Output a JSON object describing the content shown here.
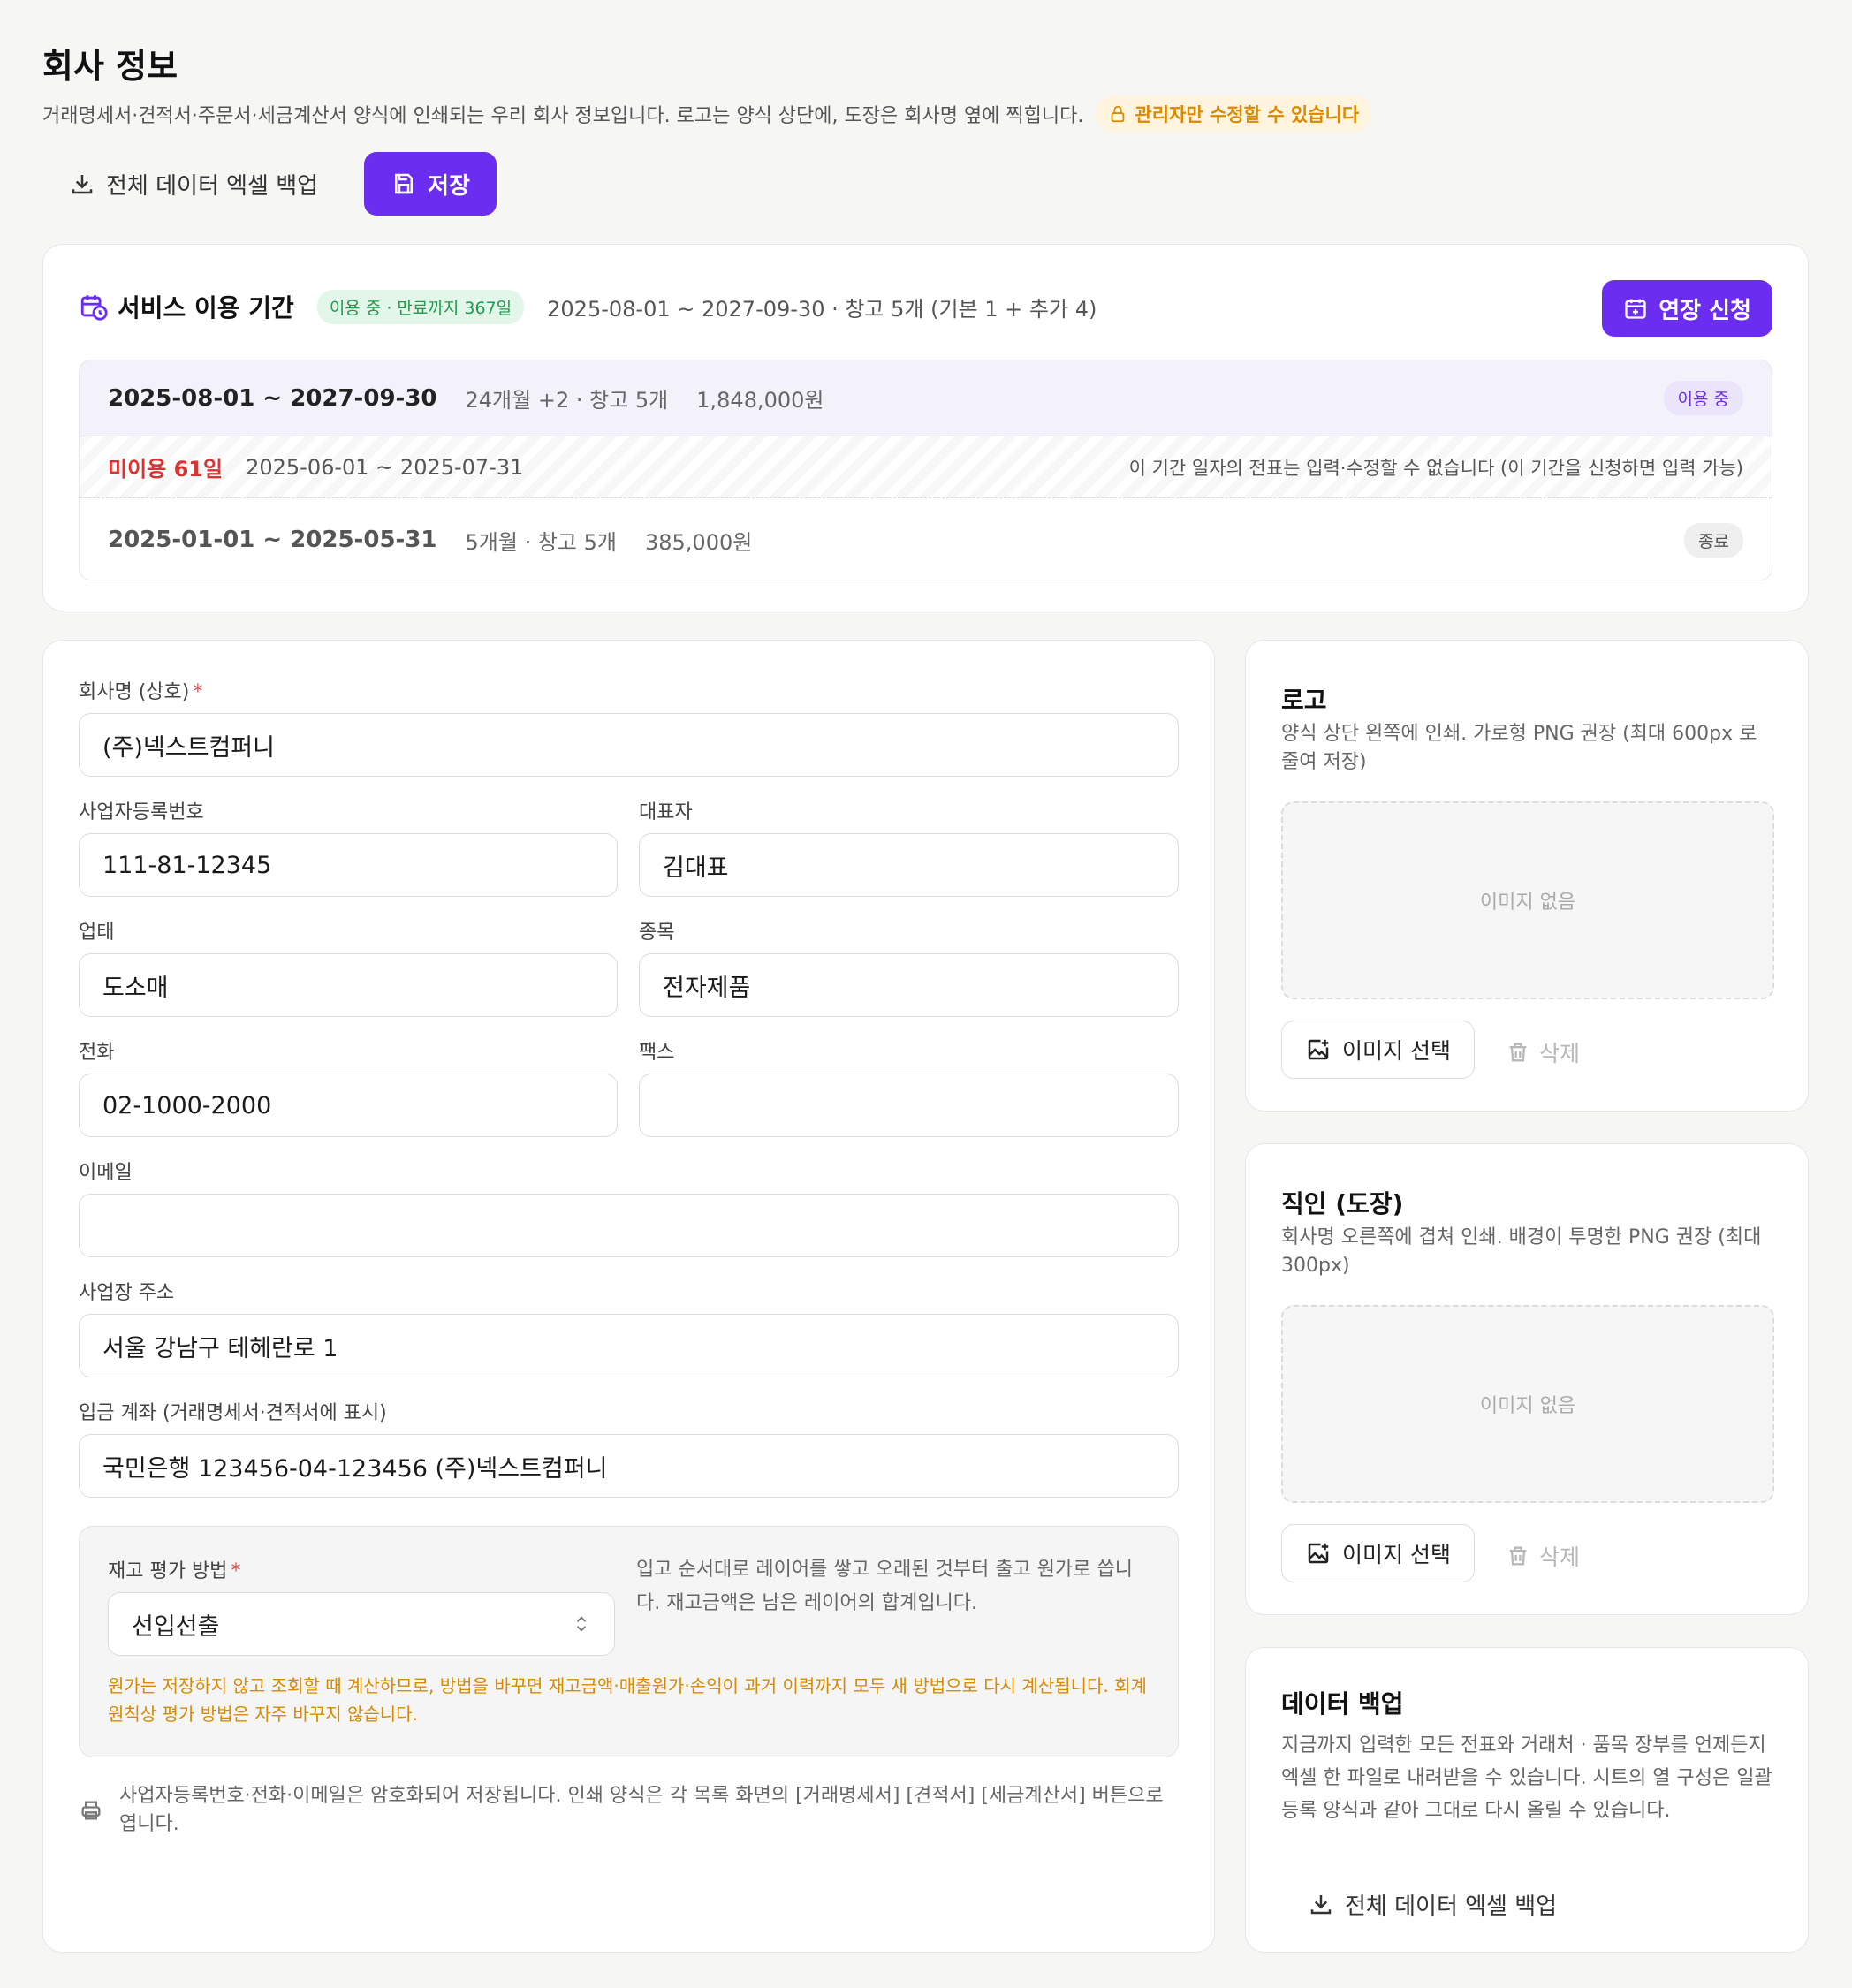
{
  "header": {
    "title": "회사 정보",
    "subtitle": "거래명세서·견적서·주문서·세금계산서 양식에 인쇄되는 우리 회사 정보입니다. 로고는 양식 상단에, 도장은 회사명 옆에 찍힙니다.",
    "admin_badge": "관리자만 수정할 수 있습니다"
  },
  "toolbar": {
    "export_label": "전체 데이터 엑셀 백업",
    "save_label": "저장"
  },
  "service": {
    "title": "서비스 이용 기간",
    "status_badge": "이용 중 · 만료까지 367일",
    "summary": "2025-08-01 ~ 2027-09-30 · 창고 5개 (기본 1 + 추가 4)",
    "extend_label": "연장 신청",
    "periods": [
      {
        "range": "2025-08-01 ~ 2027-09-30",
        "meta": "24개월 +2 · 창고 5개",
        "price": "1,848,000원",
        "status": "이용 중"
      },
      {
        "unused": "미이용 61일",
        "range": "2025-06-01 ~ 2025-07-31",
        "note": "이 기간 일자의 전표는 입력·수정할 수 없습니다 (이 기간을 신청하면 입력 가능)"
      },
      {
        "range": "2025-01-01 ~ 2025-05-31",
        "meta": "5개월 · 창고 5개",
        "price": "385,000원",
        "status": "종료"
      }
    ]
  },
  "form": {
    "company_name": {
      "label": "회사명 (상호)",
      "required": "*",
      "value": "(주)넥스트컴퍼니"
    },
    "biz_no": {
      "label": "사업자등록번호",
      "value": "111-81-12345"
    },
    "ceo": {
      "label": "대표자",
      "value": "김대표"
    },
    "biz_type": {
      "label": "업태",
      "value": "도소매"
    },
    "biz_item": {
      "label": "종목",
      "value": "전자제품"
    },
    "phone": {
      "label": "전화",
      "value": "02-1000-2000"
    },
    "fax": {
      "label": "팩스",
      "value": ""
    },
    "email": {
      "label": "이메일",
      "value": ""
    },
    "address": {
      "label": "사업장 주소",
      "value": "서울 강남구 테헤란로 1"
    },
    "account": {
      "label": "입금 계좌 (거래명세서·견적서에 표시)",
      "value": "국민은행 123456-04-123456 (주)넥스트컴퍼니"
    },
    "inventory": {
      "label": "재고 평가 방법",
      "required": "*",
      "value": "선입선출",
      "desc": "입고 순서대로 레이어를 쌓고 오래된 것부터 출고 원가로 씁니다. 재고금액은 남은 레이어의 합계입니다.",
      "warning": "원가는 저장하지 않고 조회할 때 계산하므로, 방법을 바꾸면 재고금액·매출원가·손익이 과거 이력까지 모두 새 방법으로 다시 계산됩니다. 회계 원칙상 평가 방법은 자주 바꾸지 않습니다."
    },
    "footnote": "사업자등록번호·전화·이메일은 암호화되어 저장됩니다. 인쇄 양식은 각 목록 화면의 [거래명세서] [견적서] [세금계산서] 버튼으로 엽니다."
  },
  "logo": {
    "title": "로고",
    "desc": "양식 상단 왼쪽에 인쇄. 가로형 PNG 권장 (최대 600px 로 줄여 저장)",
    "placeholder": "이미지 없음",
    "select_label": "이미지 선택",
    "delete_label": "삭제"
  },
  "seal": {
    "title": "직인 (도장)",
    "desc": "회사명 오른쪽에 겹쳐 인쇄. 배경이 투명한 PNG 권장 (최대 300px)",
    "placeholder": "이미지 없음",
    "select_label": "이미지 선택",
    "delete_label": "삭제"
  },
  "backup": {
    "title": "데이터 백업",
    "desc": "지금까지 입력한 모든 전표와 거래처 · 품목 장부를 언제든지 엑셀 한 파일로 내려받을 수 있습니다. 시트의 열 구성은 일괄 등록 양식과 같아 그대로 다시 올릴 수 있습니다.",
    "export_label": "전체 데이터 엑셀 백업"
  },
  "colors": {
    "accent": "#6b2ef0",
    "warning": "#d98a00",
    "danger": "#d93333",
    "success": "#1f9b4d"
  }
}
